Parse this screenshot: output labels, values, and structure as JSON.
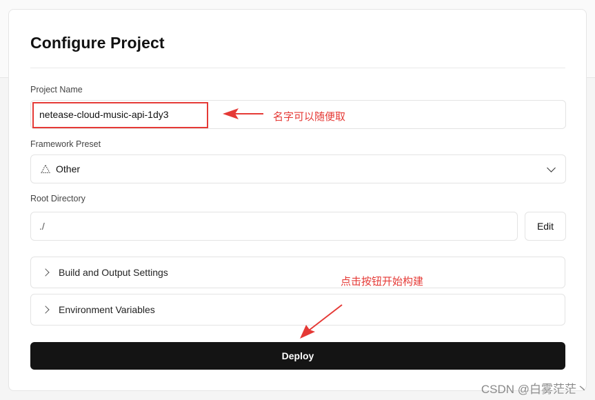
{
  "page": {
    "title": "Configure Project"
  },
  "form": {
    "project_name_label": "Project Name",
    "project_name_value": "netease-cloud-music-api-1dy3",
    "framework_label": "Framework Preset",
    "framework_icon": "triangle-icon",
    "framework_value": "Other",
    "root_dir_label": "Root Directory",
    "root_dir_value": "./",
    "edit_label": "Edit"
  },
  "sections": {
    "build_output": "Build and Output Settings",
    "env_vars": "Environment Variables"
  },
  "actions": {
    "deploy_label": "Deploy"
  },
  "annotations": {
    "name_note": "名字可以随便取",
    "deploy_note": "点击按钮开始构建",
    "color": "#e53935"
  },
  "watermark": "CSDN @白雾茫茫丶",
  "colors": {
    "deploy_bg": "#141414",
    "accent_red": "#e53935"
  }
}
